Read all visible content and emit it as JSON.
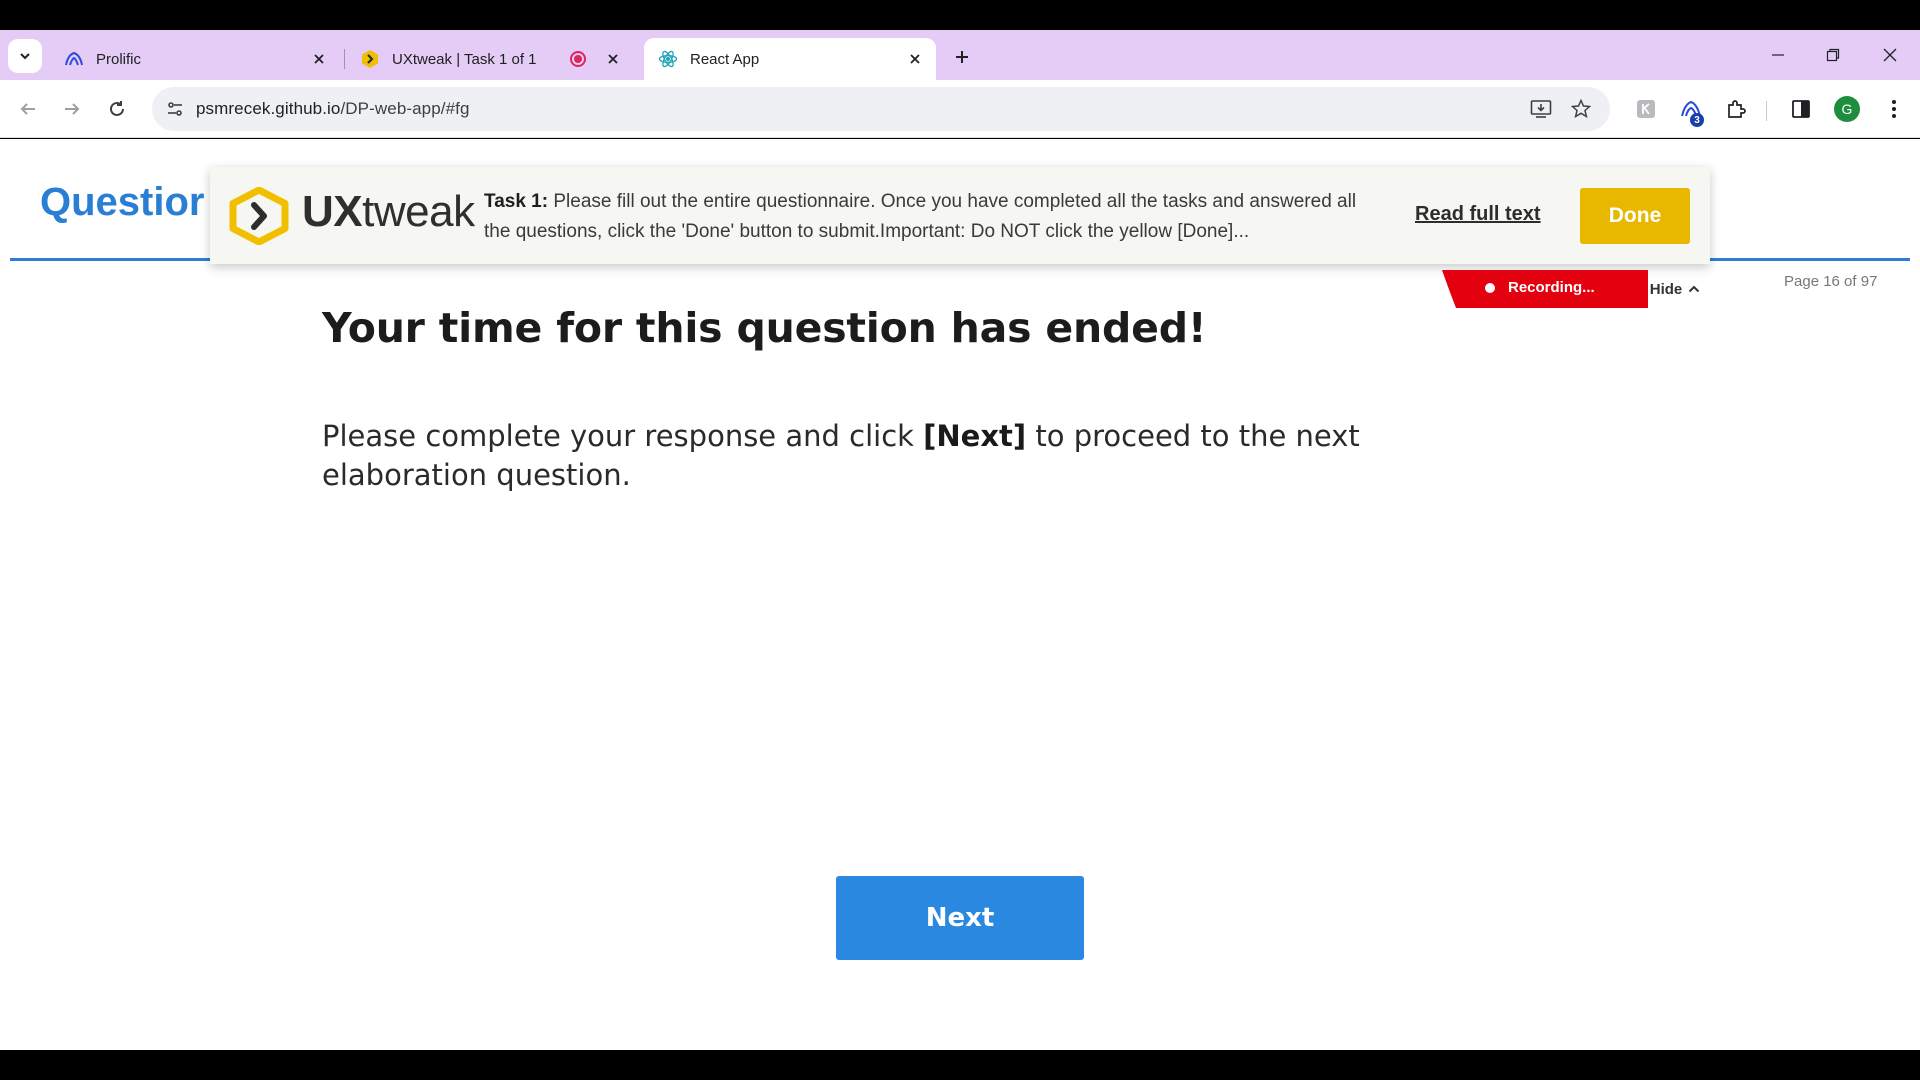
{
  "browser": {
    "tabs": [
      {
        "title": "Prolific",
        "favicon": "prolific-icon",
        "active": false
      },
      {
        "title": "UXtweak | Task 1 of 1",
        "favicon": "uxtweak-icon",
        "active": false,
        "recording": true
      },
      {
        "title": "React App",
        "favicon": "react-icon",
        "active": true
      }
    ],
    "url_domain": "psmrecek.github.io",
    "url_path": "/DP-web-app/#fg",
    "profile_initial": "G",
    "extension_badge": "3"
  },
  "page": {
    "title": "Questior",
    "page_indicator": "Page 16 of 97",
    "heading": "Your time for this question has ended!",
    "body_before": "Please complete your response and click ",
    "body_bold": "[Next]",
    "body_after": " to proceed to the next elaboration question.",
    "next_label": "Next"
  },
  "uxtweak": {
    "brand_bold": "UX",
    "brand_light": "tweak",
    "task_label": "Task 1:",
    "task_text": " Please fill out the entire questionnaire. Once you have completed all the tasks and answered all the questions, click the 'Done' button to submit.Important: Do NOT click the yellow [Done]...",
    "read_full_label": "Read full text",
    "done_label": "Done",
    "recording_label": "Recording...",
    "hide_label": "Hide",
    "colors": {
      "accent": "#e8b800",
      "recording": "#e3000f"
    }
  },
  "colors": {
    "primary": "#2b88e0",
    "tabstrip": "#e4ccf6"
  }
}
